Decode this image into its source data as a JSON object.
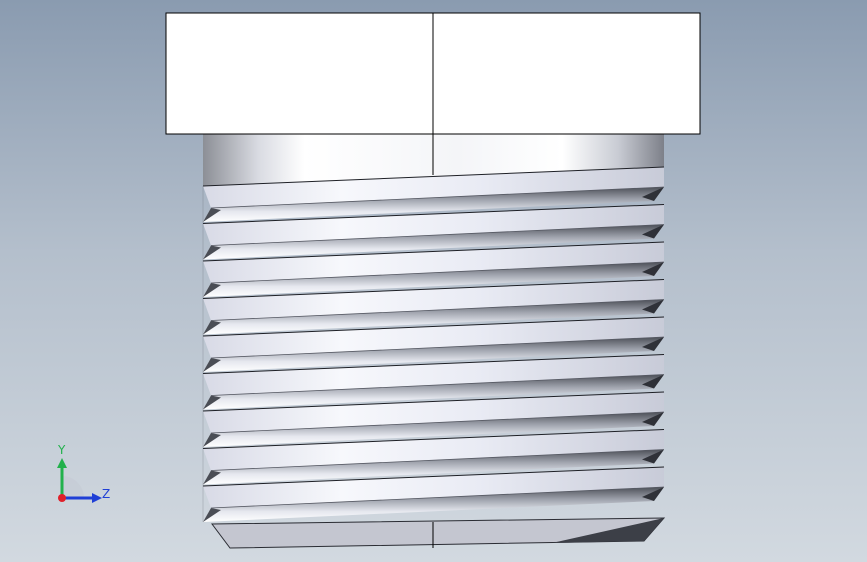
{
  "view": {
    "model": "threaded-plug",
    "thread_count": 9,
    "background_top": "#8a9bb0",
    "background_bottom": "#d2d9e0"
  },
  "triad": {
    "y_label": "Y",
    "z_label": "Z",
    "y_color": "#22b14c",
    "z_color": "#1f3fd6",
    "x_color": "#e0202a"
  }
}
